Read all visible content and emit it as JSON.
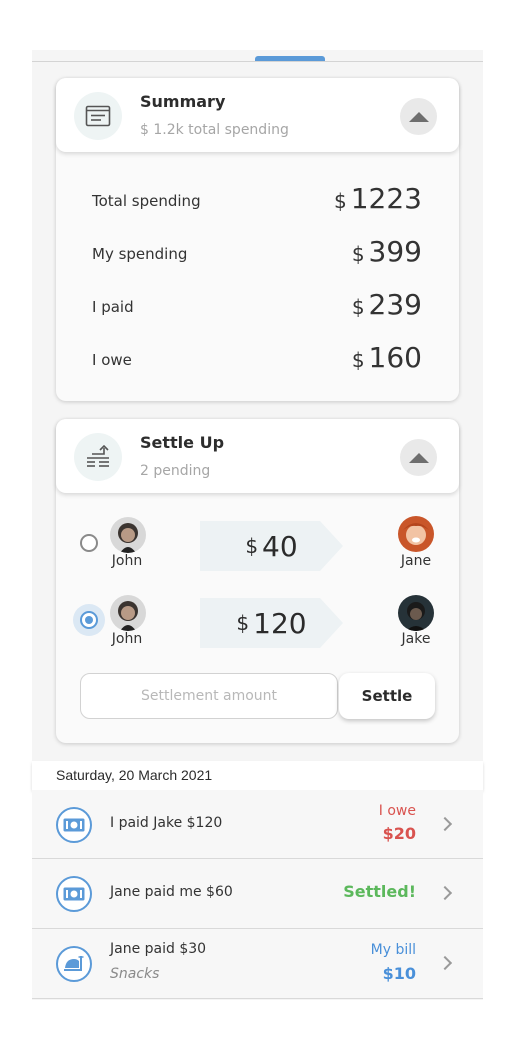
{
  "summary": {
    "title": "Summary",
    "subtitle": "$ 1.2k total spending",
    "icon": "receipt-icon",
    "rows": [
      {
        "label": "Total spending",
        "currency": "$",
        "amount": "1223"
      },
      {
        "label": "My spending",
        "currency": "$",
        "amount": "399"
      },
      {
        "label": "I paid",
        "currency": "$",
        "amount": "239"
      },
      {
        "label": "I owe",
        "currency": "$",
        "amount": "160"
      }
    ]
  },
  "settle_up": {
    "title": "Settle Up",
    "subtitle": "2 pending",
    "icon": "exchange-icon",
    "debts": [
      {
        "from": "John",
        "to": "Jane",
        "currency": "$",
        "amount": "40",
        "selected": false
      },
      {
        "from": "John",
        "to": "Jake",
        "currency": "$",
        "amount": "120",
        "selected": true
      }
    ],
    "amount_placeholder": "Settlement amount",
    "settle_label": "Settle"
  },
  "date_header": "Saturday, 20 March 2021",
  "transactions": [
    {
      "title": "I paid Jake $120",
      "subtitle": "",
      "status": "I owe",
      "amount": "$20",
      "icon": "cash-icon",
      "status_color": "#d9534f"
    },
    {
      "title": "Jane paid me $60",
      "subtitle": "",
      "status": "Settled!",
      "amount": "",
      "icon": "cash-icon",
      "status_color": "#5cb85c"
    },
    {
      "title": "Jane paid $30",
      "subtitle": "Snacks",
      "status": "My bill",
      "amount": "$10",
      "icon": "food-icon",
      "status_color": "#4a90d9"
    }
  ],
  "colors": {
    "accent": "#5b9ad8",
    "owe": "#d9534f",
    "settled": "#5cb85c",
    "bill": "#4a90d9"
  }
}
